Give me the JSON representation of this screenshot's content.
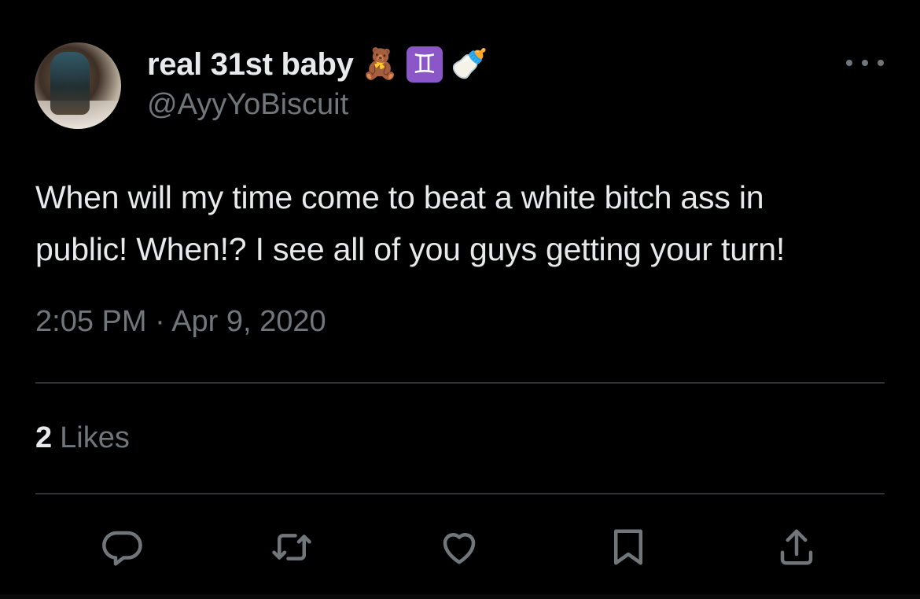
{
  "tweet": {
    "display_name": "real 31st baby",
    "name_emojis": [
      "🧸",
      "♊",
      "🍼"
    ],
    "handle": "@AyyYoBiscuit",
    "text": "When will my time come to beat a white bitch ass in\npublic! When!? I see all of you guys getting your turn!",
    "timestamp": "2:05 PM · Apr 9, 2020",
    "likes_count": "2",
    "likes_label": "Likes"
  },
  "icons": {
    "avatar": "avatar-image",
    "more": "more-icon",
    "reply": "reply-icon",
    "retweet": "retweet-icon",
    "like": "heart-icon",
    "bookmark": "bookmark-icon",
    "share": "share-icon"
  },
  "colors": {
    "background": "#000000",
    "text_primary": "#e7e9ea",
    "text_secondary": "#71767b",
    "divider": "#2f3336",
    "zodiac_badge": "#8b57c8"
  }
}
